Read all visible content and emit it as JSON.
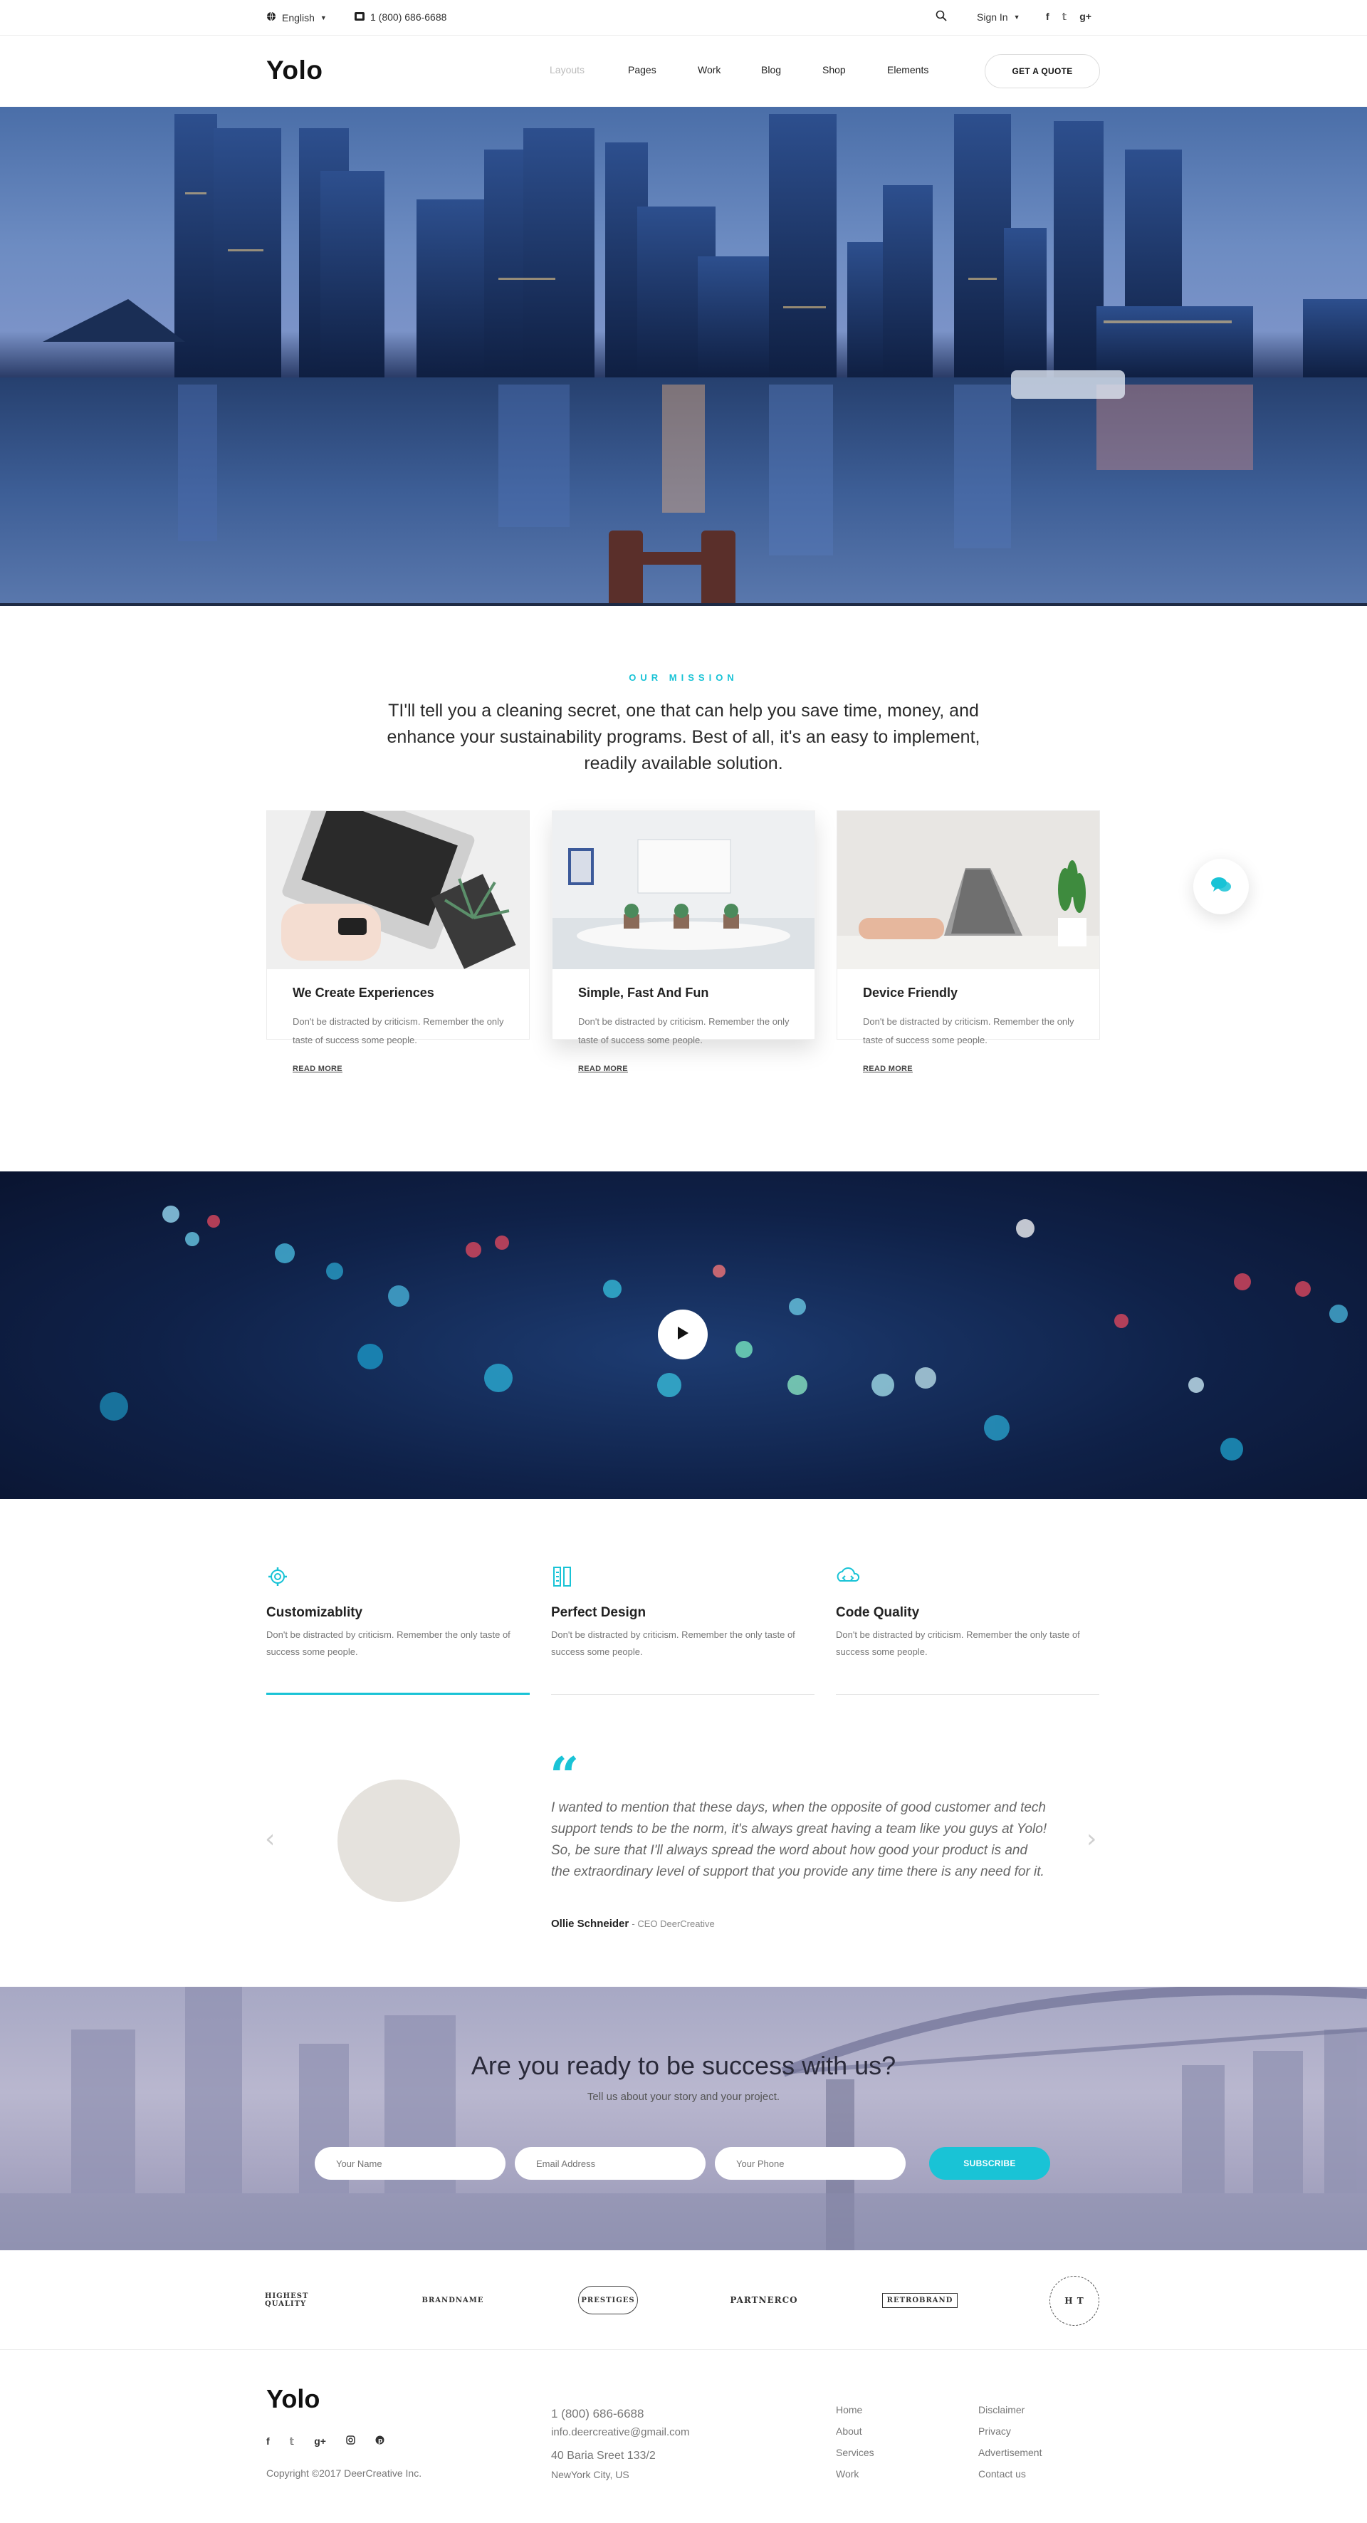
{
  "topbar": {
    "language": "English",
    "phone": "1 (800) 686-6688",
    "signin": "Sign In"
  },
  "header": {
    "logo": "Yolo",
    "nav": [
      "Layouts",
      "Pages",
      "Work",
      "Blog",
      "Shop",
      "Elements"
    ],
    "quote_button": "GET A QUOTE"
  },
  "mission": {
    "label": "OUR MISSION",
    "text": "TI'll tell you a cleaning secret, one that can help you save time, money, and enhance your sustainability programs. Best of all, it's an easy to implement, readily available solution."
  },
  "cards": [
    {
      "title": "We Create Experiences",
      "desc": "Don't be distracted by criticism. Remember the only taste of success some people.",
      "link": "READ MORE"
    },
    {
      "title": "Simple, Fast And Fun",
      "desc": "Don't be distracted by criticism. Remember the only taste of success some people.",
      "link": "READ MORE"
    },
    {
      "title": "Device Friendly",
      "desc": "Don't be distracted by criticism. Remember the only taste of success some people.",
      "link": "READ MORE"
    }
  ],
  "features": [
    {
      "title": "Customizablity",
      "desc": "Don't be distracted by criticism. Remember the only taste of success some people.",
      "icon": "gear-icon"
    },
    {
      "title": "Perfect Design",
      "desc": "Don't be distracted by criticism. Remember the only taste of success some people.",
      "icon": "pencil-ruler-icon"
    },
    {
      "title": "Code Quality",
      "desc": "Don't be distracted by criticism. Remember the only taste of success some people.",
      "icon": "cloud-code-icon"
    }
  ],
  "testimonial": {
    "quote": "I wanted to mention that these days, when the opposite of good customer and tech support tends to be the norm, it's always great having a team like you guys at Yolo! So, be sure that I'll always spread the word about how good your product is and the extraordinary level of support that you provide any time there is any need for it.",
    "author": "Ollie Schneider",
    "role": "- CEO DeerCreative"
  },
  "cta": {
    "title": "Are you ready to be success with us?",
    "subtitle": "Tell us about your story and your project.",
    "name_placeholder": "Your Name",
    "email_placeholder": "Email Address",
    "phone_placeholder": "Your Phone",
    "button": "SUBSCRIBE"
  },
  "brands": [
    "HIGHEST QUALITY",
    "BRANDNAME",
    "PRESTIGES",
    "PARTNERCO",
    "RETROBRAND",
    "H T"
  ],
  "footer": {
    "logo": "Yolo",
    "copyright": "Copyright ©2017 DeerCreative Inc.",
    "phone": "1 (800) 686-6688",
    "email": "info.deercreative@gmail.com",
    "address1": "40 Baria Sreet 133/2",
    "address2": "NewYork City, US",
    "links_col1": [
      "Home",
      "About",
      "Services",
      "Work"
    ],
    "links_col2": [
      "Disclaimer",
      "Privacy",
      "Advertisement",
      "Contact us"
    ]
  },
  "colors": {
    "accent": "#19c3d6"
  }
}
